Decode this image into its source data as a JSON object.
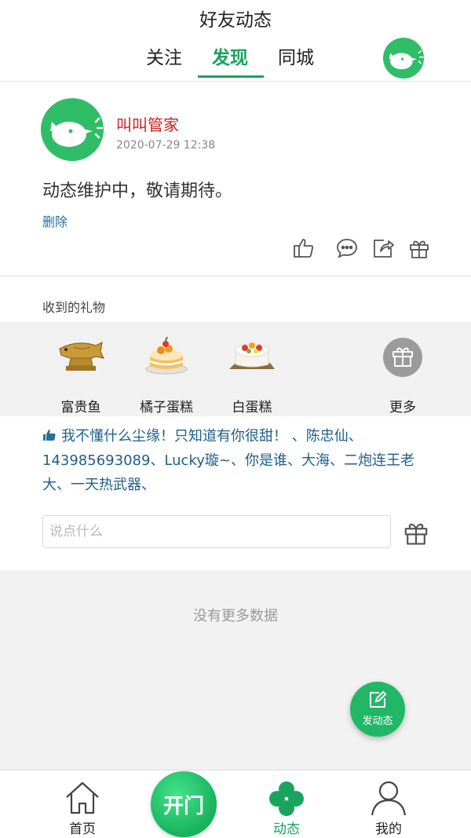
{
  "header": {
    "title": "好友动态",
    "tabs": [
      {
        "label": "关注",
        "active": false
      },
      {
        "label": "发现",
        "active": true
      },
      {
        "label": "同城",
        "active": false
      }
    ],
    "avatar_icon": "bird-logo-icon"
  },
  "post": {
    "author": "叫叫管家",
    "time": "2020-07-29 12:38",
    "content": "动态维护中，敬请期待。",
    "delete_label": "删除",
    "actions": [
      "thumbs-up-icon",
      "comment-icon",
      "share-icon",
      "gift-icon"
    ]
  },
  "gifts": {
    "label": "收到的礼物",
    "items": [
      {
        "name": "富贵鱼",
        "icon": "golden-fish-icon"
      },
      {
        "name": "橘子蛋糕",
        "icon": "orange-cake-icon"
      },
      {
        "name": "白蛋糕",
        "icon": "white-cake-icon"
      }
    ],
    "more_label": "更多"
  },
  "likes": {
    "text": "我不懂什么尘缘！只知道有你很甜！ 、陈忠仙、143985693089、Lucky璇~、你是谁、大海、二炮连王老大、一天热武器、"
  },
  "comment": {
    "placeholder": "说点什么"
  },
  "empty": {
    "text": "没有更多数据"
  },
  "fab": {
    "label": "发动态"
  },
  "bottom_nav": {
    "home": "首页",
    "open": "开门",
    "moments": "动态",
    "mine": "我的"
  },
  "colors": {
    "accent": "#1aa35f",
    "author": "#d02020",
    "link": "#1f5f88"
  }
}
